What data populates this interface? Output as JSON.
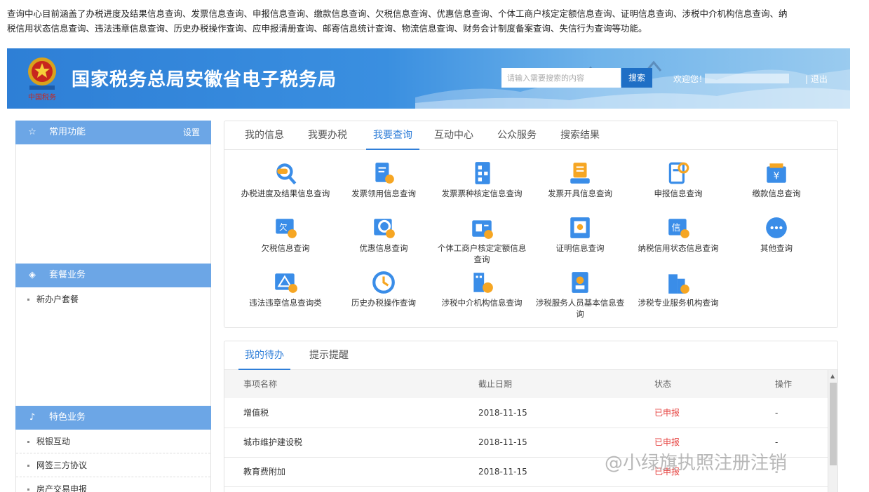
{
  "intro": {
    "line1": "查询中心目前涵盖了办税进度及结果信息查询、发票信息查询、申报信息查询、缴款信息查询、欠税信息查询、优惠信息查询、个体工商户核定定额信息查询、证明信息查询、涉税中介机构信息查询、纳",
    "line2": "税信用状态信息查询、违法违章信息查询、历史办税操作查询、应申报清册查询、邮寄信息统计查询、物流信息查询、财务会计制度备案查询、失信行为查询等功能。"
  },
  "header": {
    "title": "国家税务总局安徽省电子税务局",
    "emblem_text": "中国税务",
    "search_placeholder": "请输入需要搜索的内容",
    "search_label": "搜索",
    "welcome": "欢迎您！",
    "logout": "| 退出"
  },
  "sidebar": {
    "common": {
      "title": "常用功能",
      "settings": "设置"
    },
    "package": {
      "title": "套餐业务",
      "items": [
        "新办户套餐"
      ]
    },
    "special": {
      "title": "特色业务",
      "items": [
        "税银互动",
        "网签三方协议",
        "房产交易申报"
      ]
    }
  },
  "query_panel": {
    "tabs": [
      "我的信息",
      "我要办税",
      "我要查询",
      "互动中心",
      "公众服务",
      "搜索结果"
    ],
    "active_tab": "我要查询",
    "items": [
      {
        "label": "办税进度及结果信息查询",
        "icon": "search-progress-icon"
      },
      {
        "label": "发票领用信息查询",
        "icon": "invoice-receive-icon"
      },
      {
        "label": "发票票种核定信息查询",
        "icon": "invoice-type-icon"
      },
      {
        "label": "发票开具信息查询",
        "icon": "invoice-issue-icon"
      },
      {
        "label": "申报信息查询",
        "icon": "declare-icon"
      },
      {
        "label": "缴款信息查询",
        "icon": "payment-icon"
      },
      {
        "label": "欠税信息查询",
        "icon": "arrears-icon"
      },
      {
        "label": "优惠信息查询",
        "icon": "preferential-icon"
      },
      {
        "label": "个体工商户核定定额信息查询",
        "icon": "individual-business-icon"
      },
      {
        "label": "证明信息查询",
        "icon": "certificate-icon"
      },
      {
        "label": "纳税信用状态信息查询",
        "icon": "credit-icon"
      },
      {
        "label": "其他查询",
        "icon": "other-icon"
      },
      {
        "label": "违法违章信息查询类",
        "icon": "violation-icon"
      },
      {
        "label": "历史办税操作查询",
        "icon": "history-icon"
      },
      {
        "label": "涉税中介机构信息查询",
        "icon": "agency-icon"
      },
      {
        "label": "涉税服务人员基本信息查询",
        "icon": "staff-icon"
      },
      {
        "label": "涉税专业服务机构查询",
        "icon": "institution-icon"
      }
    ]
  },
  "todo_panel": {
    "tabs": [
      "我的待办",
      "提示提醒"
    ],
    "active_tab": "我的待办",
    "columns": [
      "事项名称",
      "截止日期",
      "状态",
      "操作"
    ],
    "rows": [
      {
        "name": "增值税",
        "date": "2018-11-15",
        "status": "已申报",
        "action": "-"
      },
      {
        "name": "城市维护建设税",
        "date": "2018-11-15",
        "status": "已申报",
        "action": "-"
      },
      {
        "name": "教育费附加",
        "date": "2018-11-15",
        "status": "已申报",
        "action": "-"
      }
    ]
  },
  "watermark": "@小绿旗执照注册注销",
  "colors": {
    "accent": "#2f7ed8",
    "sidebar_head": "#6ca6e6",
    "status_red": "#e64340",
    "banner": "#3a8fe0"
  }
}
